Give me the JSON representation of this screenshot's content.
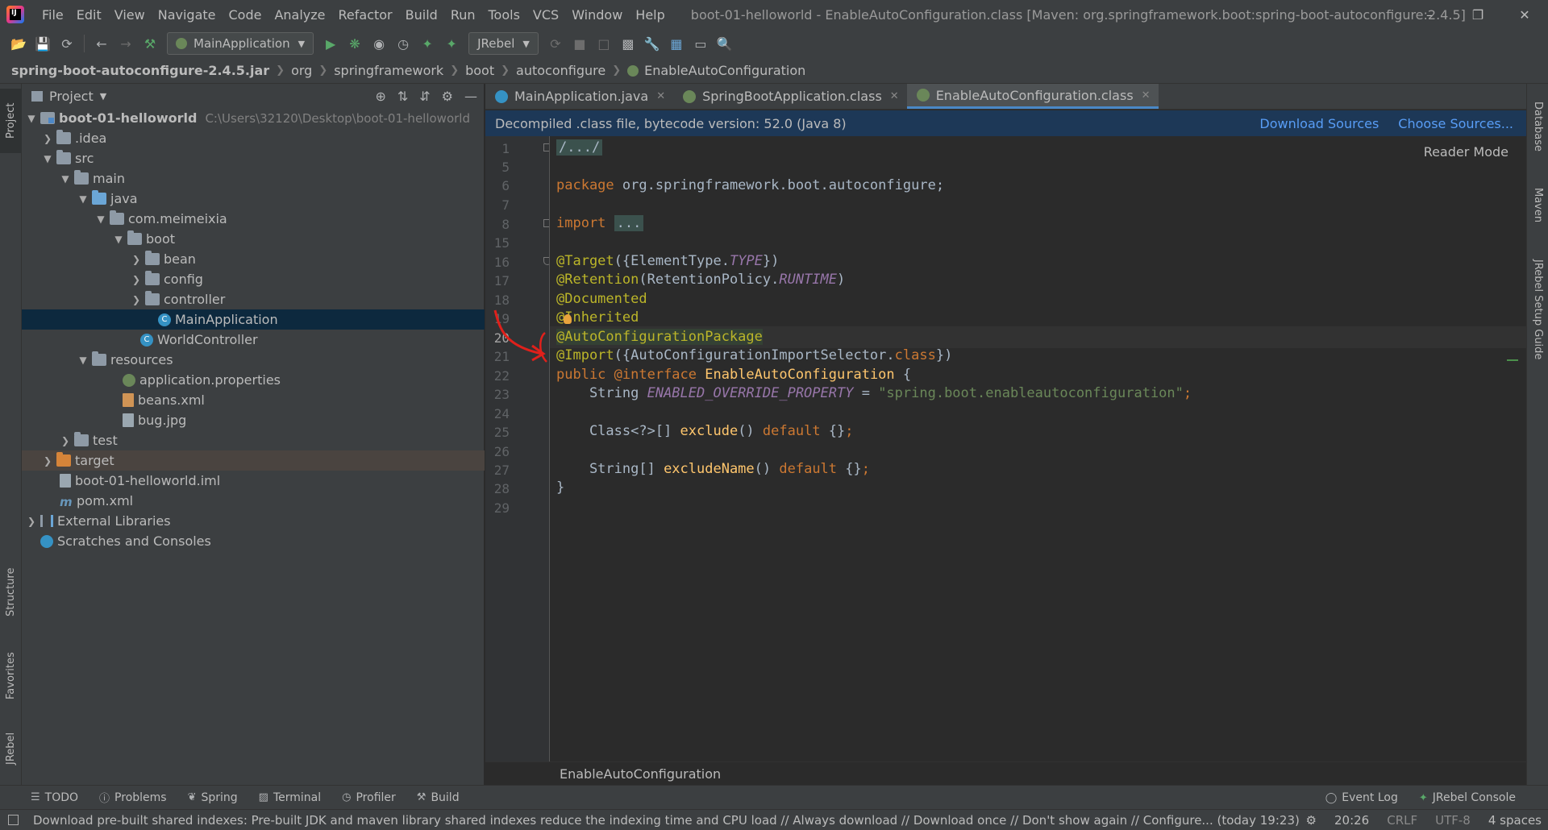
{
  "app": {
    "window_title": "boot-01-helloworld - EnableAutoConfiguration.class [Maven: org.springframework.boot:spring-boot-autoconfigure:2.4.5]",
    "logo_text": "IJ"
  },
  "menu": [
    "File",
    "Edit",
    "View",
    "Navigate",
    "Code",
    "Analyze",
    "Refactor",
    "Build",
    "Run",
    "Tools",
    "VCS",
    "Window",
    "Help"
  ],
  "toolbar": {
    "run_config": "MainApplication",
    "jrebel": "JRebel"
  },
  "breadcrumbs": [
    "spring-boot-autoconfigure-2.4.5.jar",
    "org",
    "springframework",
    "boot",
    "autoconfigure",
    "EnableAutoConfiguration"
  ],
  "left_stripe": [
    "Project",
    "Structure",
    "Favorites",
    "JRebel"
  ],
  "right_stripe": [
    "Database",
    "Maven",
    "JRebel Setup Guide"
  ],
  "project": {
    "header": "Project",
    "tree": [
      {
        "label": "boot-01-helloworld",
        "path": "C:\\Users\\32120\\Desktop\\boot-01-helloworld"
      },
      {
        "label": ".idea"
      },
      {
        "label": "src"
      },
      {
        "label": "main"
      },
      {
        "label": "java"
      },
      {
        "label": "com.meimeixia"
      },
      {
        "label": "boot"
      },
      {
        "label": "bean"
      },
      {
        "label": "config"
      },
      {
        "label": "controller"
      },
      {
        "label": "MainApplication"
      },
      {
        "label": "WorldController"
      },
      {
        "label": "resources"
      },
      {
        "label": "application.properties"
      },
      {
        "label": "beans.xml"
      },
      {
        "label": "bug.jpg"
      },
      {
        "label": "test"
      },
      {
        "label": "target"
      },
      {
        "label": "boot-01-helloworld.iml"
      },
      {
        "label": "pom.xml"
      },
      {
        "label": "External Libraries"
      },
      {
        "label": "Scratches and Consoles"
      }
    ]
  },
  "tabs": [
    {
      "label": "MainApplication.java",
      "color": "#3592c4"
    },
    {
      "label": "SpringBootApplication.class",
      "color": "#6a8759"
    },
    {
      "label": "EnableAutoConfiguration.class",
      "color": "#6a8759"
    }
  ],
  "info_bar": {
    "message": "Decompiled .class file, bytecode version: 52.0 (Java 8)",
    "download_sources": "Download Sources",
    "choose_sources": "Choose Sources..."
  },
  "editor": {
    "reader_mode": "Reader Mode",
    "line_numbers": [
      "1",
      "5",
      "6",
      "7",
      "8",
      "15",
      "16",
      "17",
      "18",
      "19",
      "20",
      "21",
      "22",
      "23",
      "24",
      "25",
      "26",
      "27",
      "28",
      "29"
    ],
    "current_line": "20",
    "code": {
      "l1": "/.../",
      "l6_kw": "package",
      "l6_rest": " org.springframework.boot.autoconfigure;",
      "l8_kw": "import",
      "l8_fold": "...",
      "l16_ann": "@Target",
      "l16_a": "({ElementType.",
      "l16_const": "TYPE",
      "l16_b": "})",
      "l17_ann": "@Retention",
      "l17_a": "(RetentionPolicy.",
      "l17_const": "RUNTIME",
      "l17_b": ")",
      "l18_ann": "@Documented",
      "l19_ann": "@Inherited",
      "l20_ann": "@AutoConfigurationPackage",
      "l21_ann": "@Import",
      "l21_a": "({AutoConfigurationImportSelector.",
      "l21_kw": "class",
      "l21_b": "})",
      "l22_kw1": "public",
      "l22_ann": " @interface",
      "l22_name": " EnableAutoConfiguration",
      "l22_b": " {",
      "l23_type": "    String ",
      "l23_const": "ENABLED_OVERRIDE_PROPERTY",
      "l23_eq": " = ",
      "l23_str": "\"spring.boot.enableautoconfiguration\"",
      "l23_end": ";",
      "l25_type": "    Class<?>[] ",
      "l25_fn": "exclude",
      "l25_a": "() ",
      "l25_kw": "default",
      "l25_b": " {}",
      "l25_end": ";",
      "l27_type": "    String[] ",
      "l27_fn": "excludeName",
      "l27_a": "() ",
      "l27_kw": "default",
      "l27_b": " {}",
      "l27_end": ";",
      "l28": "}"
    },
    "footer": "EnableAutoConfiguration"
  },
  "bottom_tools": {
    "left": [
      "TODO",
      "Problems",
      "Spring",
      "Terminal",
      "Profiler",
      "Build"
    ],
    "right": [
      "Event Log",
      "JRebel Console"
    ]
  },
  "status": {
    "message": "Download pre-built shared indexes: Pre-built JDK and maven library shared indexes reduce the indexing time and CPU load // Always download // Download once // Don't show again // Configure... (today 19:23)",
    "time": "20:26",
    "line_sep": "CRLF",
    "encoding": "UTF-8",
    "indent": "4 spaces"
  },
  "colors": {
    "accent": "#4a88c7",
    "selection": "#0d293e",
    "info_bar": "#1d3857",
    "annotation_arrow": "#e0201b"
  }
}
